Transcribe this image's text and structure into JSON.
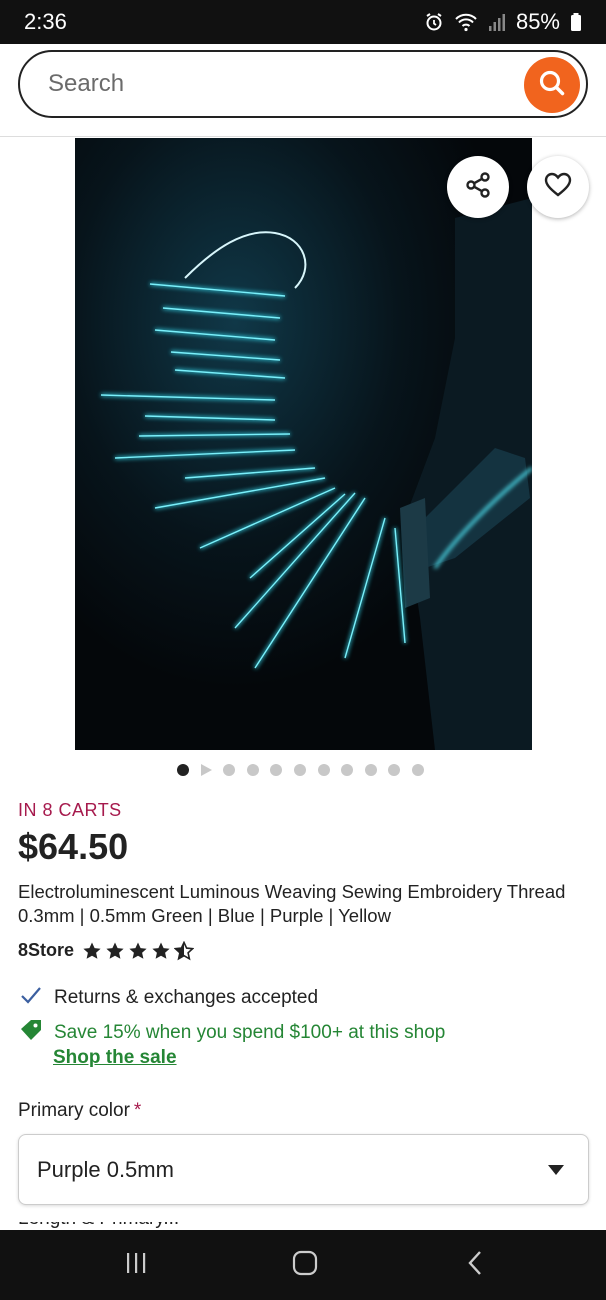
{
  "status_bar": {
    "time": "2:36",
    "battery": "85%",
    "icons": [
      "alarm-icon",
      "wifi-icon",
      "signal-icon",
      "battery-icon"
    ]
  },
  "search": {
    "placeholder": "Search",
    "button_icon": "search-icon",
    "accent_color": "#f1641e"
  },
  "gallery": {
    "image_description_icon": "product-photo",
    "share_icon": "share-icon",
    "favorite_icon": "heart-icon",
    "total_slides": 11,
    "active_slide": 1
  },
  "product": {
    "cart_notice": "IN 8 CARTS",
    "price": "$64.50",
    "title": "Electroluminescent Luminous Weaving Sewing Embroidery Thread 0.3mm | 0.5mm Green | Blue | Purple | Yellow",
    "shop_name": "8Store",
    "rating": 4.5,
    "rating_max": 5,
    "returns_text": "Returns & exchanges accepted",
    "sale_text": "Save 15% when you spend $100+ at this shop",
    "sale_link": "Shop the sale",
    "sale_color": "#258635",
    "notice_color": "#a61a4d"
  },
  "options": {
    "primary_color_label": "Primary color",
    "required_mark": "*",
    "selected_value": "Purple 0.5mm",
    "next_label_partial": "Length & Primary..."
  },
  "nav_bar": {
    "icons": [
      "recent-apps-icon",
      "home-icon",
      "back-icon"
    ]
  }
}
